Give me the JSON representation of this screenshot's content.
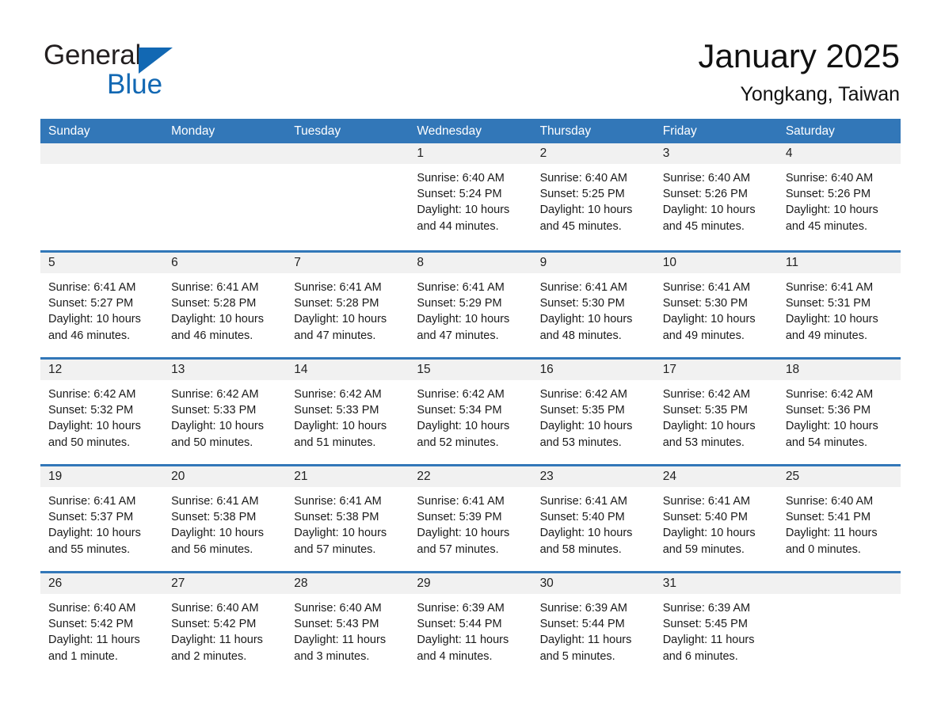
{
  "brand": {
    "name_top": "General",
    "name_bottom": "Blue",
    "triangle_icon": "triangle-icon",
    "accent_color": "#1268b3"
  },
  "header": {
    "title": "January 2025",
    "subtitle": "Yongkang, Taiwan"
  },
  "theme": {
    "header_blue": "#3277b8",
    "day_band_gray": "#f1f1f1",
    "text_color": "#1a1a1a"
  },
  "calendar": {
    "weekdays": [
      "Sunday",
      "Monday",
      "Tuesday",
      "Wednesday",
      "Thursday",
      "Friday",
      "Saturday"
    ],
    "weeks": [
      [
        {
          "day": "",
          "sunrise": "",
          "sunset": "",
          "daylight_1": "",
          "daylight_2": ""
        },
        {
          "day": "",
          "sunrise": "",
          "sunset": "",
          "daylight_1": "",
          "daylight_2": ""
        },
        {
          "day": "",
          "sunrise": "",
          "sunset": "",
          "daylight_1": "",
          "daylight_2": ""
        },
        {
          "day": "1",
          "sunrise": "Sunrise: 6:40 AM",
          "sunset": "Sunset: 5:24 PM",
          "daylight_1": "Daylight: 10 hours",
          "daylight_2": "and 44 minutes."
        },
        {
          "day": "2",
          "sunrise": "Sunrise: 6:40 AM",
          "sunset": "Sunset: 5:25 PM",
          "daylight_1": "Daylight: 10 hours",
          "daylight_2": "and 45 minutes."
        },
        {
          "day": "3",
          "sunrise": "Sunrise: 6:40 AM",
          "sunset": "Sunset: 5:26 PM",
          "daylight_1": "Daylight: 10 hours",
          "daylight_2": "and 45 minutes."
        },
        {
          "day": "4",
          "sunrise": "Sunrise: 6:40 AM",
          "sunset": "Sunset: 5:26 PM",
          "daylight_1": "Daylight: 10 hours",
          "daylight_2": "and 45 minutes."
        }
      ],
      [
        {
          "day": "5",
          "sunrise": "Sunrise: 6:41 AM",
          "sunset": "Sunset: 5:27 PM",
          "daylight_1": "Daylight: 10 hours",
          "daylight_2": "and 46 minutes."
        },
        {
          "day": "6",
          "sunrise": "Sunrise: 6:41 AM",
          "sunset": "Sunset: 5:28 PM",
          "daylight_1": "Daylight: 10 hours",
          "daylight_2": "and 46 minutes."
        },
        {
          "day": "7",
          "sunrise": "Sunrise: 6:41 AM",
          "sunset": "Sunset: 5:28 PM",
          "daylight_1": "Daylight: 10 hours",
          "daylight_2": "and 47 minutes."
        },
        {
          "day": "8",
          "sunrise": "Sunrise: 6:41 AM",
          "sunset": "Sunset: 5:29 PM",
          "daylight_1": "Daylight: 10 hours",
          "daylight_2": "and 47 minutes."
        },
        {
          "day": "9",
          "sunrise": "Sunrise: 6:41 AM",
          "sunset": "Sunset: 5:30 PM",
          "daylight_1": "Daylight: 10 hours",
          "daylight_2": "and 48 minutes."
        },
        {
          "day": "10",
          "sunrise": "Sunrise: 6:41 AM",
          "sunset": "Sunset: 5:30 PM",
          "daylight_1": "Daylight: 10 hours",
          "daylight_2": "and 49 minutes."
        },
        {
          "day": "11",
          "sunrise": "Sunrise: 6:41 AM",
          "sunset": "Sunset: 5:31 PM",
          "daylight_1": "Daylight: 10 hours",
          "daylight_2": "and 49 minutes."
        }
      ],
      [
        {
          "day": "12",
          "sunrise": "Sunrise: 6:42 AM",
          "sunset": "Sunset: 5:32 PM",
          "daylight_1": "Daylight: 10 hours",
          "daylight_2": "and 50 minutes."
        },
        {
          "day": "13",
          "sunrise": "Sunrise: 6:42 AM",
          "sunset": "Sunset: 5:33 PM",
          "daylight_1": "Daylight: 10 hours",
          "daylight_2": "and 50 minutes."
        },
        {
          "day": "14",
          "sunrise": "Sunrise: 6:42 AM",
          "sunset": "Sunset: 5:33 PM",
          "daylight_1": "Daylight: 10 hours",
          "daylight_2": "and 51 minutes."
        },
        {
          "day": "15",
          "sunrise": "Sunrise: 6:42 AM",
          "sunset": "Sunset: 5:34 PM",
          "daylight_1": "Daylight: 10 hours",
          "daylight_2": "and 52 minutes."
        },
        {
          "day": "16",
          "sunrise": "Sunrise: 6:42 AM",
          "sunset": "Sunset: 5:35 PM",
          "daylight_1": "Daylight: 10 hours",
          "daylight_2": "and 53 minutes."
        },
        {
          "day": "17",
          "sunrise": "Sunrise: 6:42 AM",
          "sunset": "Sunset: 5:35 PM",
          "daylight_1": "Daylight: 10 hours",
          "daylight_2": "and 53 minutes."
        },
        {
          "day": "18",
          "sunrise": "Sunrise: 6:42 AM",
          "sunset": "Sunset: 5:36 PM",
          "daylight_1": "Daylight: 10 hours",
          "daylight_2": "and 54 minutes."
        }
      ],
      [
        {
          "day": "19",
          "sunrise": "Sunrise: 6:41 AM",
          "sunset": "Sunset: 5:37 PM",
          "daylight_1": "Daylight: 10 hours",
          "daylight_2": "and 55 minutes."
        },
        {
          "day": "20",
          "sunrise": "Sunrise: 6:41 AM",
          "sunset": "Sunset: 5:38 PM",
          "daylight_1": "Daylight: 10 hours",
          "daylight_2": "and 56 minutes."
        },
        {
          "day": "21",
          "sunrise": "Sunrise: 6:41 AM",
          "sunset": "Sunset: 5:38 PM",
          "daylight_1": "Daylight: 10 hours",
          "daylight_2": "and 57 minutes."
        },
        {
          "day": "22",
          "sunrise": "Sunrise: 6:41 AM",
          "sunset": "Sunset: 5:39 PM",
          "daylight_1": "Daylight: 10 hours",
          "daylight_2": "and 57 minutes."
        },
        {
          "day": "23",
          "sunrise": "Sunrise: 6:41 AM",
          "sunset": "Sunset: 5:40 PM",
          "daylight_1": "Daylight: 10 hours",
          "daylight_2": "and 58 minutes."
        },
        {
          "day": "24",
          "sunrise": "Sunrise: 6:41 AM",
          "sunset": "Sunset: 5:40 PM",
          "daylight_1": "Daylight: 10 hours",
          "daylight_2": "and 59 minutes."
        },
        {
          "day": "25",
          "sunrise": "Sunrise: 6:40 AM",
          "sunset": "Sunset: 5:41 PM",
          "daylight_1": "Daylight: 11 hours",
          "daylight_2": "and 0 minutes."
        }
      ],
      [
        {
          "day": "26",
          "sunrise": "Sunrise: 6:40 AM",
          "sunset": "Sunset: 5:42 PM",
          "daylight_1": "Daylight: 11 hours",
          "daylight_2": "and 1 minute."
        },
        {
          "day": "27",
          "sunrise": "Sunrise: 6:40 AM",
          "sunset": "Sunset: 5:42 PM",
          "daylight_1": "Daylight: 11 hours",
          "daylight_2": "and 2 minutes."
        },
        {
          "day": "28",
          "sunrise": "Sunrise: 6:40 AM",
          "sunset": "Sunset: 5:43 PM",
          "daylight_1": "Daylight: 11 hours",
          "daylight_2": "and 3 minutes."
        },
        {
          "day": "29",
          "sunrise": "Sunrise: 6:39 AM",
          "sunset": "Sunset: 5:44 PM",
          "daylight_1": "Daylight: 11 hours",
          "daylight_2": "and 4 minutes."
        },
        {
          "day": "30",
          "sunrise": "Sunrise: 6:39 AM",
          "sunset": "Sunset: 5:44 PM",
          "daylight_1": "Daylight: 11 hours",
          "daylight_2": "and 5 minutes."
        },
        {
          "day": "31",
          "sunrise": "Sunrise: 6:39 AM",
          "sunset": "Sunset: 5:45 PM",
          "daylight_1": "Daylight: 11 hours",
          "daylight_2": "and 6 minutes."
        },
        {
          "day": "",
          "sunrise": "",
          "sunset": "",
          "daylight_1": "",
          "daylight_2": ""
        }
      ]
    ]
  }
}
